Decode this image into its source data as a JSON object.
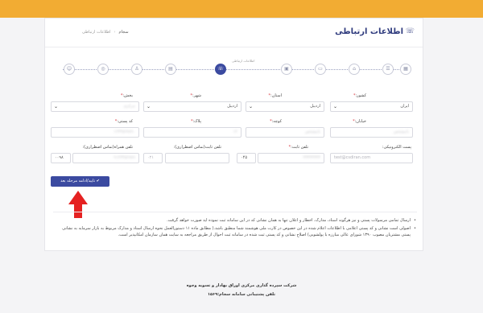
{
  "page": {
    "title": "اطلاعات ارتباطی"
  },
  "breadcrumb": {
    "home": "سجام",
    "current": "اطلاعات ارتباطی"
  },
  "steps": {
    "current_label": "اطلاعات ارتباطی",
    "items": [
      {
        "icon": "user-circle-icon",
        "glyph": "☺",
        "active": false
      },
      {
        "icon": "target-icon",
        "glyph": "◎",
        "active": false
      },
      {
        "icon": "person-icon",
        "glyph": "♙",
        "active": false
      },
      {
        "icon": "id-card-icon",
        "glyph": "▤",
        "active": false
      },
      {
        "icon": "phone-icon",
        "glyph": "☏",
        "active": true
      },
      {
        "icon": "briefcase-icon",
        "glyph": "▣",
        "active": false
      },
      {
        "icon": "bank-card-icon",
        "glyph": "▭",
        "active": false
      },
      {
        "icon": "bank-icon",
        "glyph": "⌂",
        "active": false
      },
      {
        "icon": "file-list-icon",
        "glyph": "☰",
        "active": false
      },
      {
        "icon": "document-icon",
        "glyph": "▦",
        "active": false
      }
    ]
  },
  "form": {
    "country": {
      "label": "کشور",
      "value": "ایران"
    },
    "province": {
      "label": "استان",
      "value": "اردبیل"
    },
    "city": {
      "label": "شهر",
      "value": "اردبیل"
    },
    "district": {
      "label": "بخش",
      "value": "مرکزی"
    },
    "street": {
      "label": "خیابان",
      "value": "نامشخص"
    },
    "alley": {
      "label": "کوچه",
      "value": "نامشخص"
    },
    "plaque": {
      "label": "پلاک",
      "value": "۱۲"
    },
    "postal_code": {
      "label": "کد پستی",
      "value": "۱۲۳۴۵۶۷۸۹۰"
    },
    "email": {
      "label": "پست الکترونیکی",
      "placeholder": "test@csdiran.com"
    },
    "fixed_phone": {
      "label": "تلفن ثابت",
      "prefix": "۰۴۵",
      "value": "۳۳۳۳۳۳۳۳"
    },
    "emergency_fixed_phone": {
      "label": "تلفن ثابت(تماس اضطراری)",
      "prefix": "۰۲۱",
      "value": ""
    },
    "emergency_mobile": {
      "label": "تلفن همراه(تماس اضطراری)",
      "prefix": "۰۰۹۸",
      "value": "۹۱۲۳۴۵۶۷۸۹"
    },
    "submit_label": "تایید/ادامه مرحله بعد"
  },
  "notes": [
    "ارسال تمامی مرسولات پستی و نیز هرگونه اسناد، مدارک، اخطار و اعلان تنها به همان نشانی که در این سامانه ثبت نموده اید صورت خواهد گرفت.",
    "اصولی است نشانی و کد پستی اعلامی با اطلاعات اعلام شده در این خصوص در کارت ملی هوشمند شما منطبق باشد.( مطابق ماده ۱۱ دستورالعمل نحوه ارسال اسناد و مدارک مربوط به بازار سرمایه به نشانی پستی مشتریان مصوب ۱۳۹۰ شورای عالی مبارزه با پولشویی) اصلاح نشانی و کد پستی ثبت شده در سامانه ثبت احوال از طریق مراجعه به سایت همان سازمان امکانپذیر است."
  ],
  "footer": {
    "company": "شرکت سپرده گذاری مرکزی اوراق بهادار و تسویه وجوه",
    "support": "تلفن پشتیبانی سامانه سجام:۱۵۶۹"
  },
  "colors": {
    "top_bar": "#f2ac33",
    "primary": "#3b4aa0",
    "title": "#2e3a7d",
    "required": "#d9363e",
    "annotation_arrow": "#e52222"
  }
}
